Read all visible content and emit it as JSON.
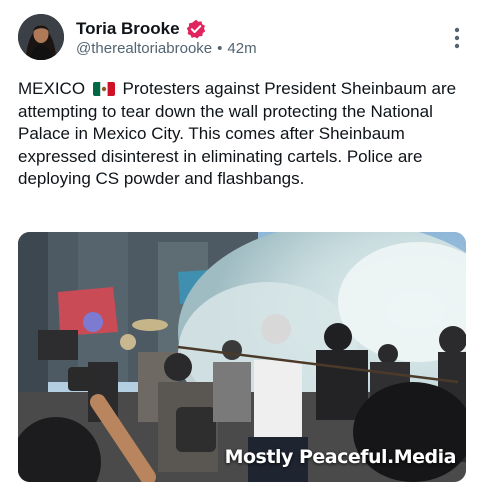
{
  "post": {
    "author": {
      "display_name": "Toria Brooke",
      "handle": "@therealtoriabrooke",
      "separator": "•",
      "time": "42m",
      "verified": true,
      "verified_color": "#e0245e"
    },
    "text_prefix": "MEXICO",
    "text_body": "Protesters against President Sheinbaum are attempting to tear down the wall protecting the National Palace in Mexico City. This comes after Sheinbaum expressed disinterest in eliminating cartels. Police are deploying CS powder and flashbangs.",
    "media": {
      "watermark": "Mostly Peaceful.Media",
      "description_icon": "protest-photo"
    }
  },
  "colors": {
    "text_primary": "#0f1419",
    "text_secondary": "#536471"
  }
}
